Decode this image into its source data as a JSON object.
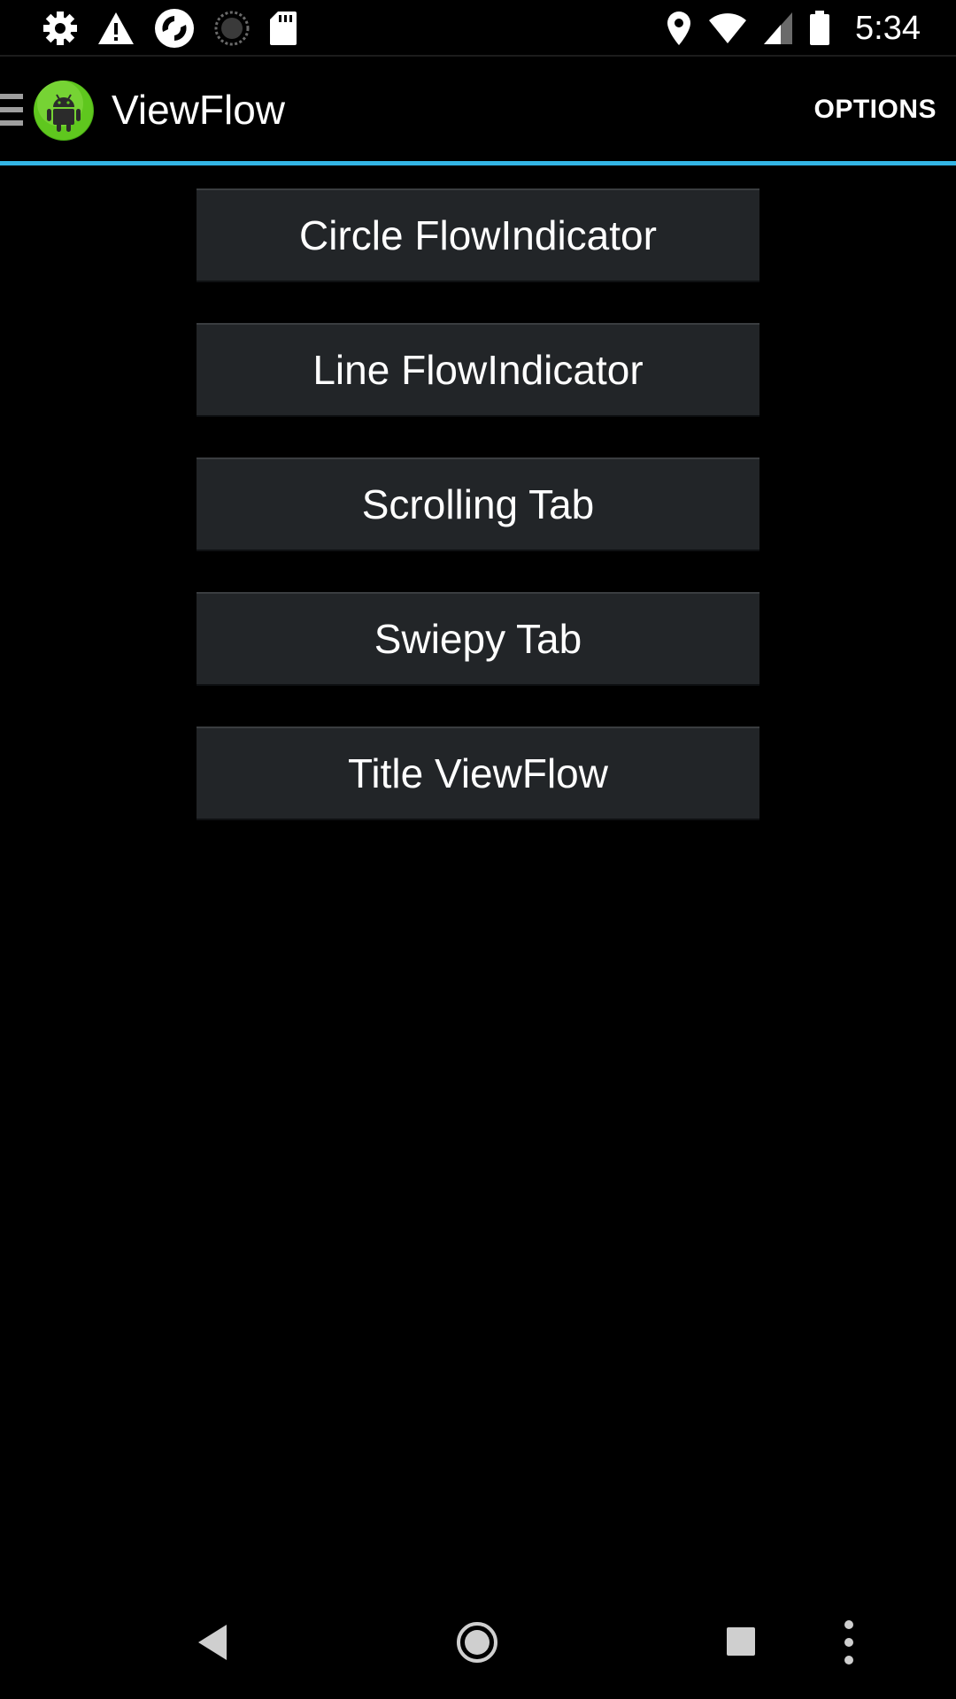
{
  "status_bar": {
    "left_icons": [
      "settings-gear-icon",
      "warning-icon",
      "sync-icon",
      "loading-spinner-icon",
      "sd-card-icon"
    ],
    "right_icons": [
      "location-pin-icon",
      "wifi-icon",
      "cell-signal-icon",
      "battery-icon"
    ],
    "time": "5:34"
  },
  "action_bar": {
    "app_icon": "android-app-icon",
    "title": "ViewFlow",
    "options_label": "OPTIONS",
    "accent_color": "#33b5e5"
  },
  "menu": {
    "buttons": [
      {
        "label": "Circle FlowIndicator"
      },
      {
        "label": "Line FlowIndicator"
      },
      {
        "label": "Scrolling Tab"
      },
      {
        "label": "Swiepy Tab"
      },
      {
        "label": "Title ViewFlow"
      }
    ]
  },
  "nav_bar": {
    "icons": [
      "back-icon",
      "home-icon",
      "recents-icon",
      "overflow-menu-icon"
    ]
  }
}
